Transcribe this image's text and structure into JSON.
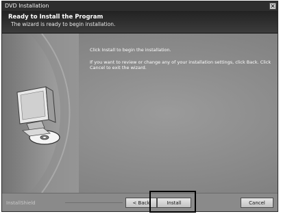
{
  "window": {
    "title": "DVD Installation"
  },
  "header": {
    "title": "Ready to Install the Program",
    "subtitle": "The wizard is ready to begin installation."
  },
  "content": {
    "instruction_1": "Click Install to begin the installation.",
    "instruction_2": "If you want to review or change any of your installation settings, click Back. Click Cancel to exit the wizard."
  },
  "footer": {
    "brand": "InstallShield",
    "back_label": "< Back",
    "install_label": "Install",
    "cancel_label": "Cancel"
  },
  "icons": {
    "close": "close-icon",
    "artwork": "computer-disc-artwork"
  }
}
